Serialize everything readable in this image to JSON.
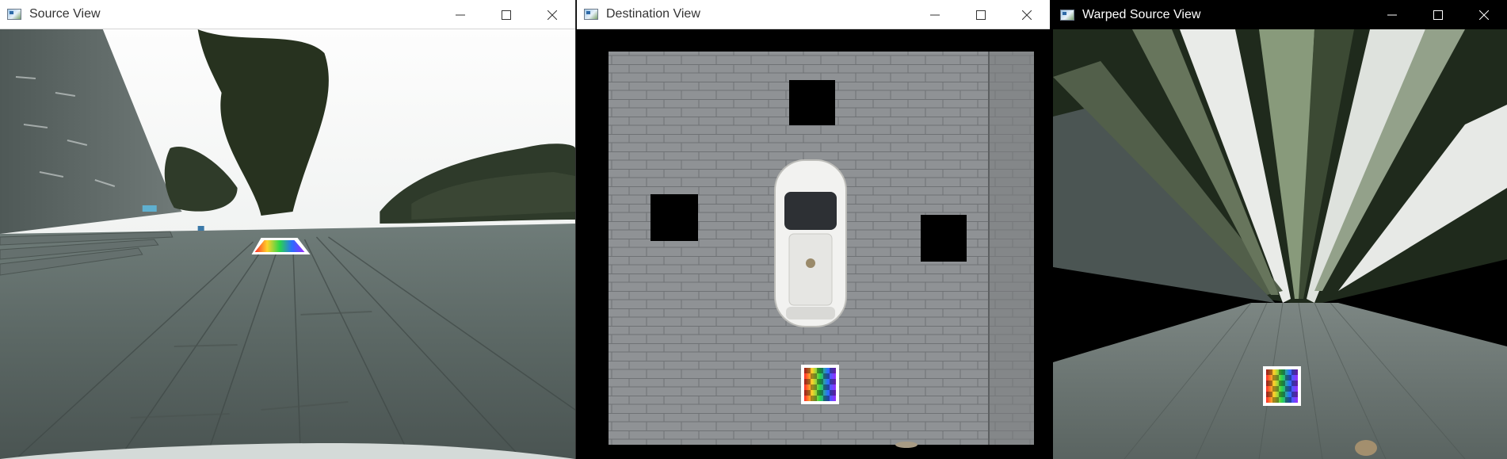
{
  "windows": {
    "source": {
      "title": "Source View",
      "controls": {
        "minimize": "minimize-icon",
        "maximize": "maximize-icon",
        "close": "close-icon"
      }
    },
    "destination": {
      "title": "Destination View",
      "controls": {
        "minimize": "minimize-icon",
        "maximize": "maximize-icon",
        "close": "close-icon"
      }
    },
    "warped": {
      "title": "Warped Source View",
      "controls": {
        "minimize": "minimize-icon",
        "maximize": "maximize-icon",
        "close": "close-icon"
      }
    }
  },
  "colors": {
    "titlebar_light": "#ffffff",
    "titlebar_dark": "#000000",
    "pavement": "#5f6b68",
    "sky": "#f1f3f1",
    "foliage": "#2f3a2b",
    "topdown_paving": "#8e9194"
  }
}
